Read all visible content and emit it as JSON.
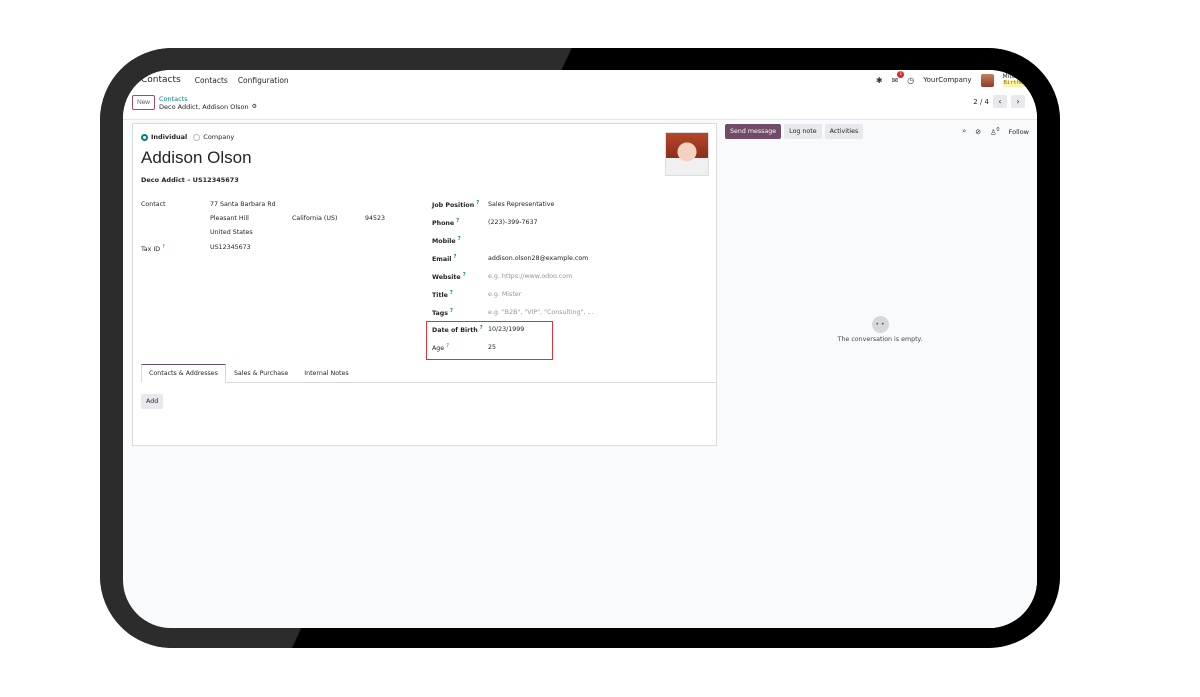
{
  "navbar": {
    "app_name": "Contacts",
    "menu": [
      "Contacts",
      "Configuration"
    ],
    "company": "YourCompany",
    "user_name": "Mitchell",
    "user_status": "Birthday",
    "message_count": "1"
  },
  "control": {
    "new_label": "New",
    "breadcrumb_parent": "Contacts",
    "breadcrumb_current": "Deco Addict, Addison Olson",
    "pager": "2 / 4",
    "prev": "‹",
    "next": "›"
  },
  "form": {
    "type_individual": "Individual",
    "type_company": "Company",
    "name": "Addison Olson",
    "company_line": "Deco Addict – US12345673",
    "contact_label": "Contact",
    "street": "77 Santa Barbara Rd",
    "city": "Pleasant Hill",
    "state": "California (US)",
    "zip": "94523",
    "country": "United States",
    "tax_label": "Tax ID",
    "tax_value": "US12345673",
    "job_label": "Job Position",
    "job_value": "Sales Representative",
    "phone_label": "Phone",
    "phone_value": "(223)-399-7637",
    "mobile_label": "Mobile",
    "email_label": "Email",
    "email_value": "addison.olson28@example.com",
    "website_label": "Website",
    "website_placeholder": "e.g. https://www.odoo.com",
    "title_label": "Title",
    "title_placeholder": "e.g. Mister",
    "tags_label": "Tags",
    "tags_placeholder": "e.g. \"B2B\", \"VIP\", \"Consulting\", ...",
    "dob_label": "Date of Birth",
    "dob_value": "10/23/1999",
    "age_label": "Age",
    "age_value": "25",
    "help_mark": "?"
  },
  "tabs": [
    "Contacts & Addresses",
    "Sales & Purchase",
    "Internal Notes"
  ],
  "add_label": "Add",
  "chatter": {
    "send_message": "Send message",
    "log_note": "Log note",
    "activities": "Activities",
    "follower_count": "0",
    "follow": "Follow",
    "empty_text": "The conversation is empty."
  }
}
